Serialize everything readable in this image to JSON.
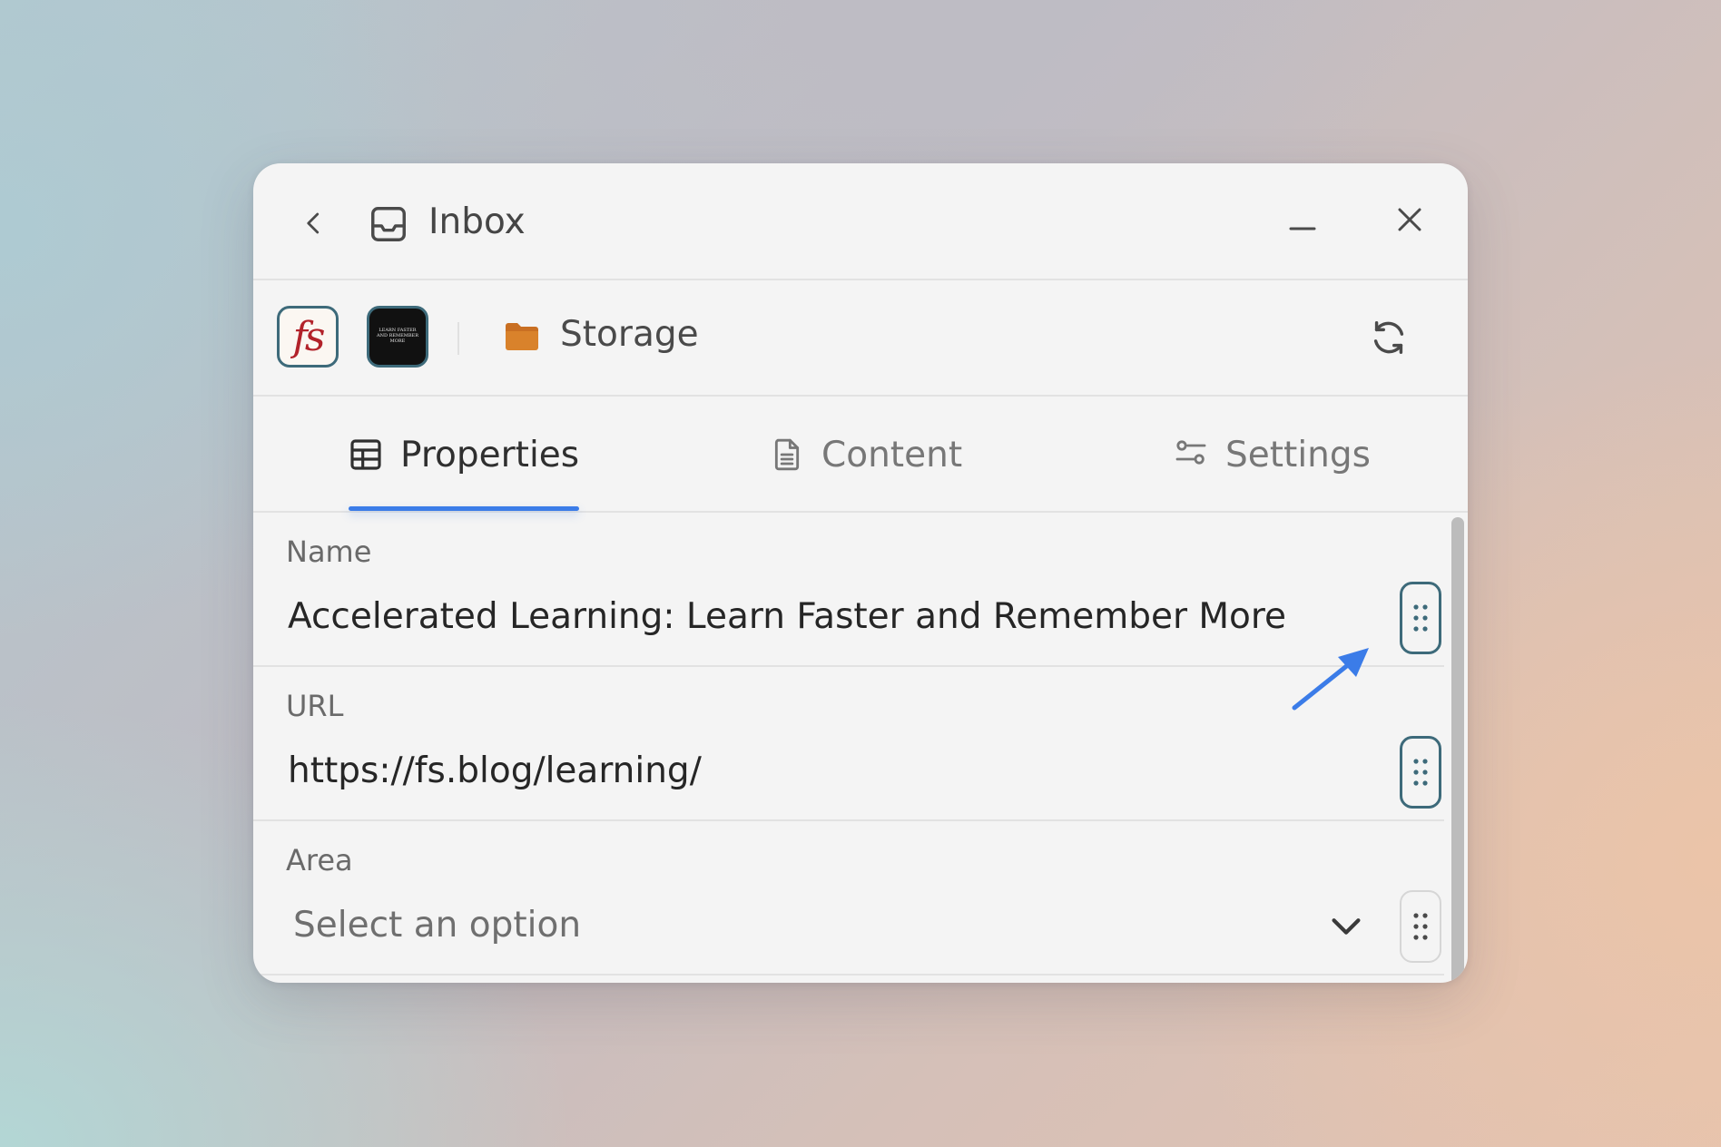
{
  "window": {
    "title": "Inbox"
  },
  "sourcebar": {
    "logo_text": "fs",
    "thumbnail_text": "LEARN FASTER AND REMEMBER MORE",
    "location": "Storage"
  },
  "tabs": [
    {
      "label": "Properties",
      "active": true
    },
    {
      "label": "Content",
      "active": false
    },
    {
      "label": "Settings",
      "active": false
    }
  ],
  "fields": {
    "name": {
      "label": "Name",
      "value": "Accelerated Learning: Learn Faster and Remember More"
    },
    "url": {
      "label": "URL",
      "value": "https://fs.blog/learning/"
    },
    "area": {
      "label": "Area",
      "placeholder": "Select an option"
    }
  },
  "colors": {
    "accent": "#3b7ce8",
    "folder": "#d9822b",
    "logo_red": "#b2222a",
    "handle_border": "#3d6a7a"
  },
  "icons": {
    "back": "chevron-left-icon",
    "inbox": "inbox-tray-icon",
    "minimize": "minimize-icon",
    "close": "close-icon",
    "folder": "folder-icon",
    "refresh": "refresh-icon",
    "properties": "table-grid-icon",
    "content": "document-icon",
    "settings": "sliders-icon",
    "drag": "drag-dots-icon",
    "dropdown": "chevron-down-icon"
  }
}
